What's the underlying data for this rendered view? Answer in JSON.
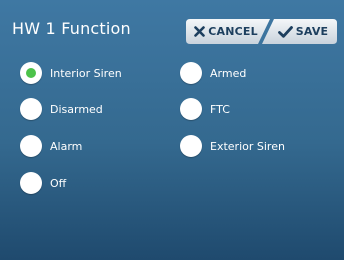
{
  "header": {
    "title": "HW 1 Function",
    "cancel_label": "CANCEL",
    "save_label": "SAVE"
  },
  "options": [
    {
      "label": "Interior Siren",
      "selected": true
    },
    {
      "label": "Disarmed",
      "selected": false
    },
    {
      "label": "Alarm",
      "selected": false
    },
    {
      "label": "Off",
      "selected": false
    },
    {
      "label": "Armed",
      "selected": false
    },
    {
      "label": "FTC",
      "selected": false
    },
    {
      "label": "Exterior Siren",
      "selected": false
    }
  ],
  "colors": {
    "background": "#3a6f96",
    "button_face": "#dfe6ec",
    "button_text": "#1d3f5e",
    "selected_dot": "#4cc24a"
  },
  "icons": {
    "cancel": "x-icon",
    "save": "checkmark-icon"
  }
}
